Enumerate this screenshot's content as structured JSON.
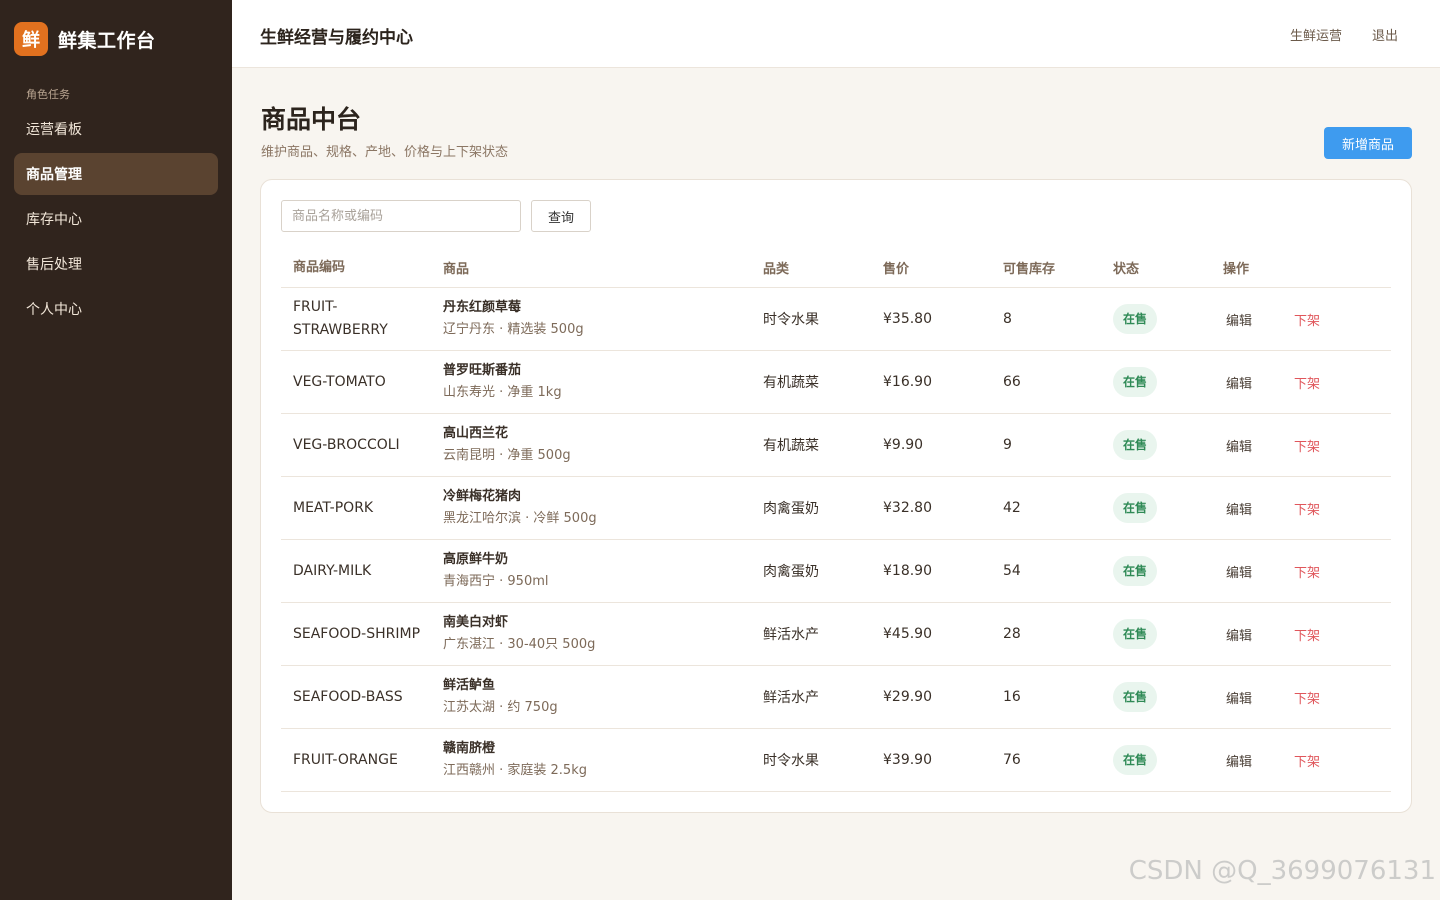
{
  "brand": {
    "logo_char": "鲜",
    "name": "鲜集工作台"
  },
  "sidebar": {
    "section_label": "角色任务",
    "items": [
      {
        "label": "运营看板"
      },
      {
        "label": "商品管理"
      },
      {
        "label": "库存中心"
      },
      {
        "label": "售后处理"
      },
      {
        "label": "个人中心"
      }
    ]
  },
  "header": {
    "title": "生鲜经营与履约中心",
    "role": "生鲜运营",
    "logout": "退出"
  },
  "page": {
    "title": "商品中台",
    "subtitle": "维护商品、规格、产地、价格与上下架状态",
    "add_label": "新增商品"
  },
  "search": {
    "placeholder": "商品名称或编码",
    "value": "",
    "button": "查询"
  },
  "table": {
    "headers": {
      "code": "商品编码",
      "product": "商品",
      "category": "品类",
      "price": "售价",
      "stock": "可售库存",
      "status": "状态",
      "ops": "操作"
    },
    "rows": [
      {
        "code": "FRUIT-STRAWBERRY",
        "name": "丹东红颜草莓",
        "meta": "辽宁丹东 · 精选装 500g",
        "category": "时令水果",
        "price": "¥35.80",
        "stock": "8",
        "status": "在售",
        "edit": "编辑",
        "off": "下架"
      },
      {
        "code": "VEG-TOMATO",
        "name": "普罗旺斯番茄",
        "meta": "山东寿光 · 净重 1kg",
        "category": "有机蔬菜",
        "price": "¥16.90",
        "stock": "66",
        "status": "在售",
        "edit": "编辑",
        "off": "下架"
      },
      {
        "code": "VEG-BROCCOLI",
        "name": "高山西兰花",
        "meta": "云南昆明 · 净重 500g",
        "category": "有机蔬菜",
        "price": "¥9.90",
        "stock": "9",
        "status": "在售",
        "edit": "编辑",
        "off": "下架"
      },
      {
        "code": "MEAT-PORK",
        "name": "冷鲜梅花猪肉",
        "meta": "黑龙江哈尔滨 · 冷鲜 500g",
        "category": "肉禽蛋奶",
        "price": "¥32.80",
        "stock": "42",
        "status": "在售",
        "edit": "编辑",
        "off": "下架"
      },
      {
        "code": "DAIRY-MILK",
        "name": "高原鲜牛奶",
        "meta": "青海西宁 · 950ml",
        "category": "肉禽蛋奶",
        "price": "¥18.90",
        "stock": "54",
        "status": "在售",
        "edit": "编辑",
        "off": "下架"
      },
      {
        "code": "SEAFOOD-SHRIMP",
        "name": "南美白对虾",
        "meta": "广东湛江 · 30-40只 500g",
        "category": "鲜活水产",
        "price": "¥45.90",
        "stock": "28",
        "status": "在售",
        "edit": "编辑",
        "off": "下架"
      },
      {
        "code": "SEAFOOD-BASS",
        "name": "鲜活鲈鱼",
        "meta": "江苏太湖 · 约 750g",
        "category": "鲜活水产",
        "price": "¥29.90",
        "stock": "16",
        "status": "在售",
        "edit": "编辑",
        "off": "下架"
      },
      {
        "code": "FRUIT-ORANGE",
        "name": "赣南脐橙",
        "meta": "江西赣州 · 家庭装 2.5kg",
        "category": "时令水果",
        "price": "¥39.90",
        "stock": "76",
        "status": "在售",
        "edit": "编辑",
        "off": "下架"
      }
    ]
  },
  "watermark": "CSDN @Q_3699076131",
  "colors": {
    "sidebar_bg": "#30241d",
    "accent": "#e1711f",
    "primary_button": "#3e9bef",
    "status_green": "#2f8a56",
    "danger": "#e0565b"
  }
}
